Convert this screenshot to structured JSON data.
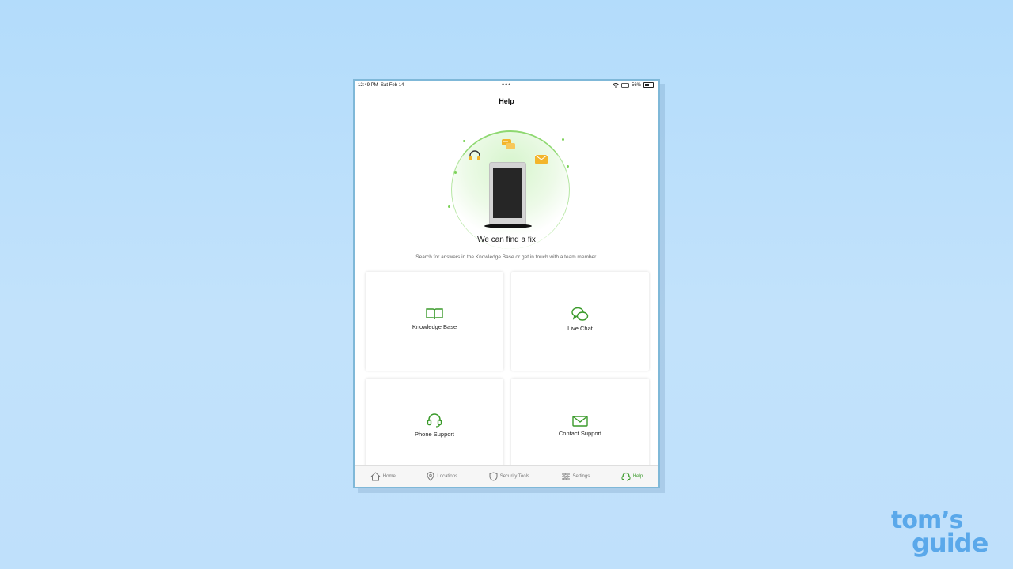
{
  "status_bar": {
    "time": "12:49 PM",
    "date": "Sat Feb 14",
    "battery_percent": "56%"
  },
  "header": {
    "title": "Help"
  },
  "hero": {
    "headline": "We can find a fix",
    "subtitle": "Search for answers in the Knowledge Base or get in touch with a team member."
  },
  "cards": [
    {
      "label": "Knowledge Base",
      "icon": "book-icon"
    },
    {
      "label": "Live Chat",
      "icon": "chat-icon"
    },
    {
      "label": "Phone Support",
      "icon": "headset-icon"
    },
    {
      "label": "Contact Support",
      "icon": "envelope-icon"
    }
  ],
  "tabs": [
    {
      "label": "Home",
      "icon": "home-icon"
    },
    {
      "label": "Locations",
      "icon": "location-pin-icon"
    },
    {
      "label": "Security Tools",
      "icon": "shield-icon"
    },
    {
      "label": "Settings",
      "icon": "sliders-icon"
    },
    {
      "label": "Help",
      "icon": "headset-icon",
      "active": true
    }
  ],
  "colors": {
    "accent": "#3a9a2a",
    "background": "#bfe0fb",
    "logo": "#5aa8ea"
  },
  "watermark": {
    "line1": "tom’s",
    "line2": "guide"
  }
}
